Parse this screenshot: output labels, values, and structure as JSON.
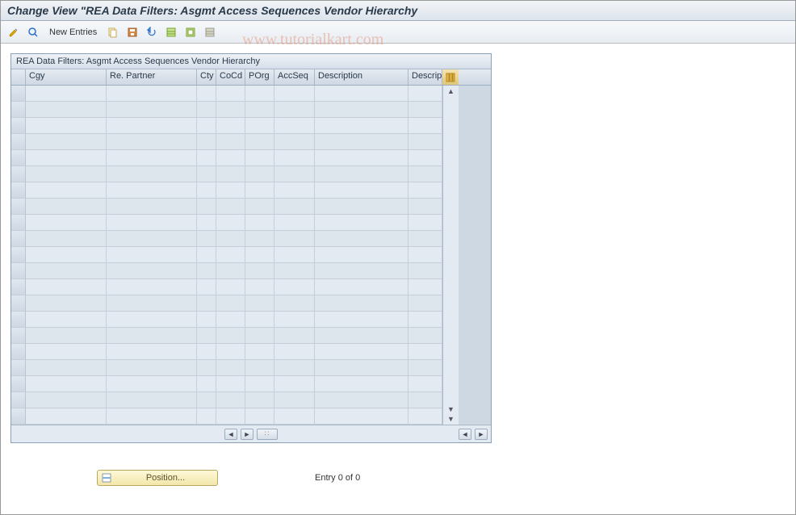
{
  "title": "Change View \"REA Data Filters: Asgmt Access Sequences Vendor Hierarchy",
  "toolbar": {
    "new_entries_label": "New Entries"
  },
  "panel": {
    "title": "REA Data Filters: Asgmt Access Sequences Vendor Hierarchy",
    "columns": {
      "cgy": "Cgy",
      "re_partner": "Re. Partner",
      "cty": "Cty",
      "cocd": "CoCd",
      "porg": "POrg",
      "accseq": "AccSeq",
      "description": "Description",
      "descript2": "Descript"
    },
    "rows": []
  },
  "footer": {
    "position_label": "Position...",
    "entry_text": "Entry 0 of 0"
  },
  "watermark": "www.tutorialkart.com"
}
